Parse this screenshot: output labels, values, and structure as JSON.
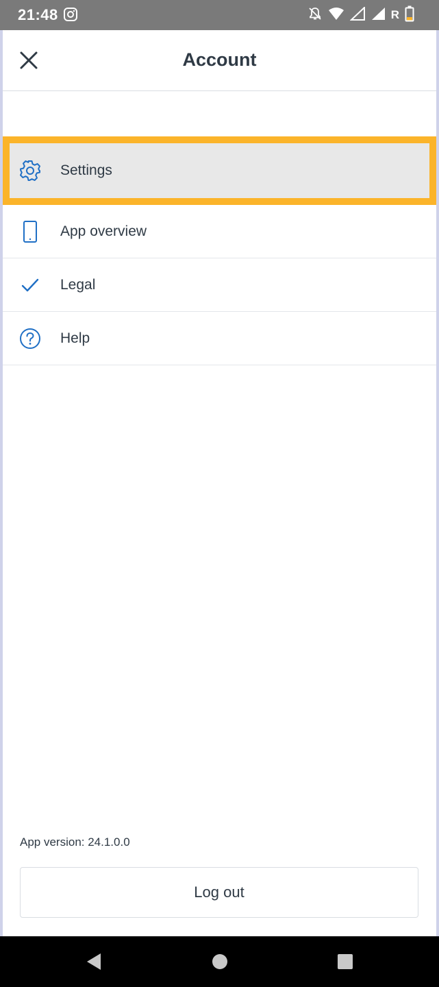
{
  "status_bar": {
    "time": "21:48",
    "carrier_flag": "R",
    "icons": [
      "instagram-icon",
      "notifications-off-icon",
      "wifi-icon",
      "signal-icon",
      "signal-icon",
      "battery-icon"
    ],
    "battery_color": "#fbb42a"
  },
  "header": {
    "title": "Account",
    "close_icon": "close-icon"
  },
  "menu": {
    "items": [
      {
        "label": "Settings",
        "icon": "gear-icon",
        "highlighted": true
      },
      {
        "label": "App overview",
        "icon": "smartphone-icon",
        "highlighted": false
      },
      {
        "label": "Legal",
        "icon": "checkmark-icon",
        "highlighted": false
      },
      {
        "label": "Help",
        "icon": "help-circle-icon",
        "highlighted": false
      }
    ]
  },
  "footer": {
    "version_text": "App version: 24.1.0.0",
    "logout_label": "Log out"
  },
  "colors": {
    "accent": "#1f6fc5",
    "highlight_border": "#fbb42a",
    "highlight_bg": "#e8e8e8",
    "text": "#2f3a45"
  },
  "nav_bar": {
    "buttons": [
      "back-icon",
      "home-icon",
      "recents-icon"
    ]
  }
}
